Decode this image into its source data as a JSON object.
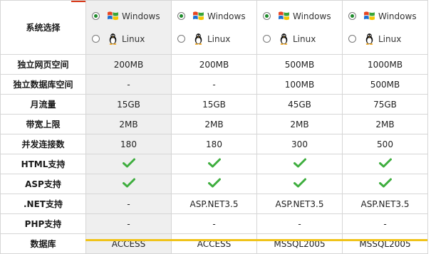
{
  "row_labels": {
    "system": "系统选择",
    "web_space": "独立网页空间",
    "db_space": "独立数据库空间",
    "traffic": "月流量",
    "bandwidth": "带宽上限",
    "connections": "并发连接数",
    "html": "HTML支持",
    "asp": "ASP支持",
    "dotnet": ".NET支持",
    "php": "PHP支持",
    "database": "数据库"
  },
  "os_labels": {
    "windows": "Windows",
    "linux": "Linux"
  },
  "icons": {
    "windows": "windows-logo-icon",
    "linux": "linux-penguin-icon",
    "supported": "green-check-icon"
  },
  "colors": {
    "check": "#3fae3f",
    "radio_selected": "#1d8a2a",
    "shaded_column": "#efefef",
    "bottom_bar": "#f0c319"
  },
  "plans": [
    {
      "selected_os": "windows",
      "web_space": "200MB",
      "db_space": "-",
      "traffic": "15GB",
      "bandwidth": "2MB",
      "connections": "180",
      "html": true,
      "asp": true,
      "dotnet": "-",
      "php": "-",
      "database": "ACCESS"
    },
    {
      "selected_os": "windows",
      "web_space": "200MB",
      "db_space": "-",
      "traffic": "15GB",
      "bandwidth": "2MB",
      "connections": "180",
      "html": true,
      "asp": true,
      "dotnet": "ASP.NET3.5",
      "php": "-",
      "database": "ACCESS"
    },
    {
      "selected_os": "windows",
      "web_space": "500MB",
      "db_space": "100MB",
      "traffic": "45GB",
      "bandwidth": "2MB",
      "connections": "300",
      "html": true,
      "asp": true,
      "dotnet": "ASP.NET3.5",
      "php": "-",
      "database": "MSSQL2005"
    },
    {
      "selected_os": "windows",
      "web_space": "1000MB",
      "db_space": "500MB",
      "traffic": "75GB",
      "bandwidth": "2MB",
      "connections": "500",
      "html": true,
      "asp": true,
      "dotnet": "ASP.NET3.5",
      "php": "-",
      "database": "MSSQL2005"
    }
  ]
}
